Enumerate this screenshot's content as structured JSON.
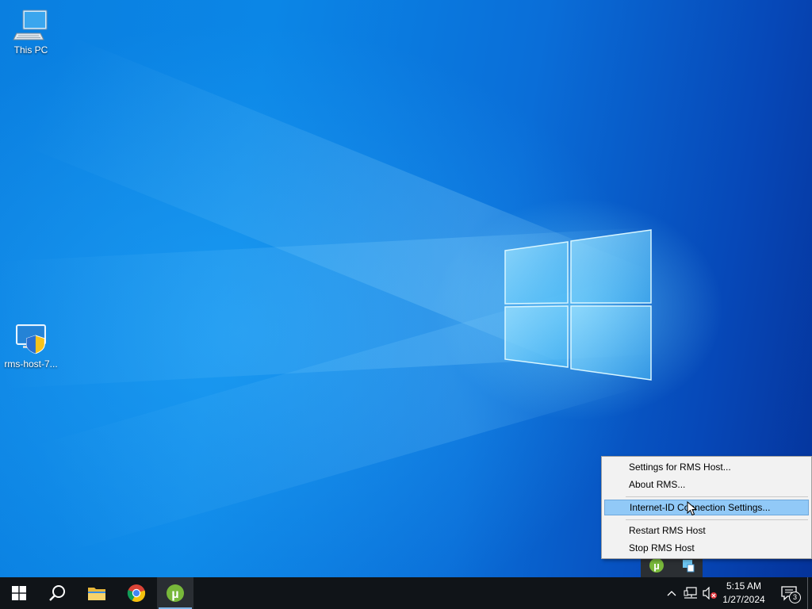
{
  "desktop": {
    "icons": [
      {
        "label": "This PC",
        "icon": "monitor-icon"
      },
      {
        "label": "rms-host-7...",
        "icon": "installer-shield-icon"
      }
    ]
  },
  "context_menu": {
    "items": [
      {
        "label": "Settings for RMS Host..."
      },
      {
        "label": "About RMS..."
      },
      {
        "label": "Internet-ID Connection Settings...",
        "highlighted": true
      },
      {
        "label": "Restart RMS Host"
      },
      {
        "label": "Stop RMS Host"
      }
    ]
  },
  "taskbar": {
    "start_icon": "windows-start-icon",
    "search_icon": "search-icon",
    "pinned": [
      {
        "name": "file-explorer",
        "icon": "folder-icon"
      },
      {
        "name": "chrome",
        "icon": "chrome-icon"
      },
      {
        "name": "utorrent",
        "icon": "utorrent-icon",
        "active": true
      }
    ],
    "tray": {
      "overflow_icons": [
        "utorrent-icon",
        "rms-host-icon"
      ],
      "icons": [
        "chevron-up-icon",
        "network-icon",
        "volume-muted-icon"
      ],
      "time": "5:15 AM",
      "date": "1/27/2024",
      "notification_count": "3"
    }
  },
  "colors": {
    "taskbar": "#101418",
    "menu_highlight": "#91c9f7",
    "desktop_blue": "#0a7fe0"
  }
}
